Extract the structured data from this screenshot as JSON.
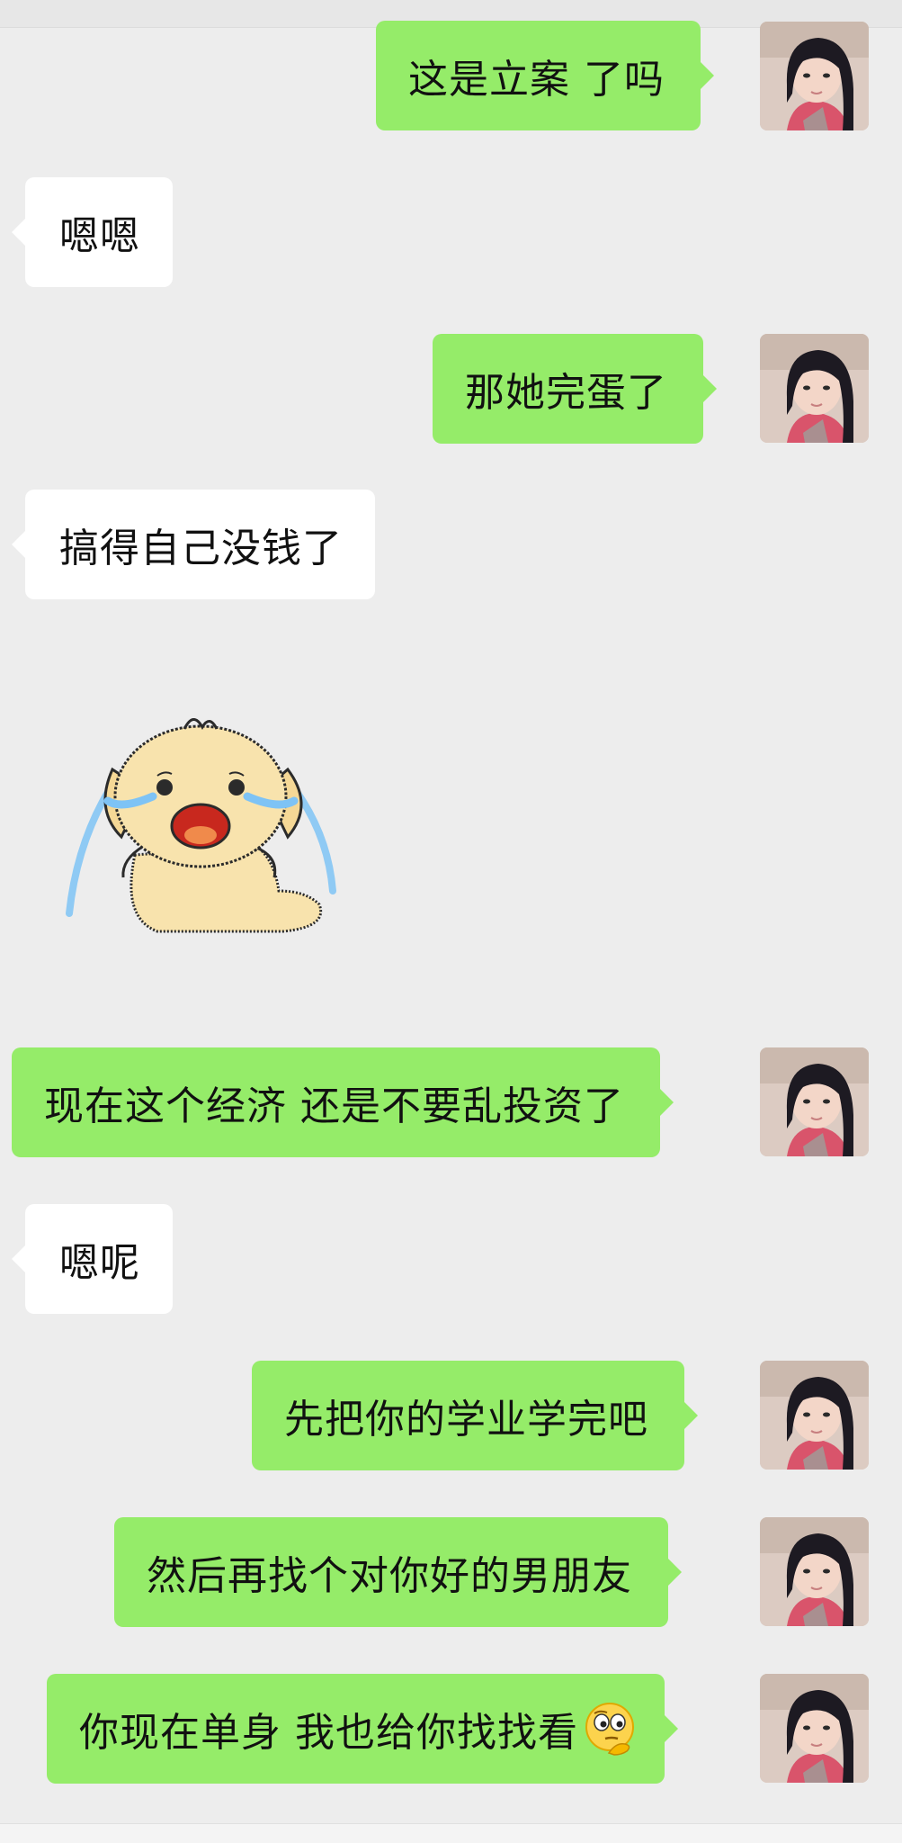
{
  "messages": [
    {
      "side": "out",
      "text": "这是立案 了吗"
    },
    {
      "side": "in",
      "text": "嗯嗯"
    },
    {
      "side": "out",
      "text": "那她完蛋了"
    },
    {
      "side": "in",
      "text": "搞得自己没钱了"
    },
    {
      "side": "in",
      "sticker": "crying-puppy-sticker"
    },
    {
      "side": "out",
      "text": "现在这个经济 还是不要乱投资了"
    },
    {
      "side": "in",
      "text": "嗯呢"
    },
    {
      "side": "out",
      "text": "先把你的学业学完吧"
    },
    {
      "side": "out",
      "text": "然后再找个对你好的男朋友"
    },
    {
      "side": "out",
      "text": "你现在单身 我也给你找找看",
      "emoji": "thinking-face-emoji"
    }
  ],
  "colors": {
    "background": "#ededed",
    "outgoing_bubble": "#95ec69",
    "incoming_bubble": "#ffffff",
    "text": "#111111"
  }
}
